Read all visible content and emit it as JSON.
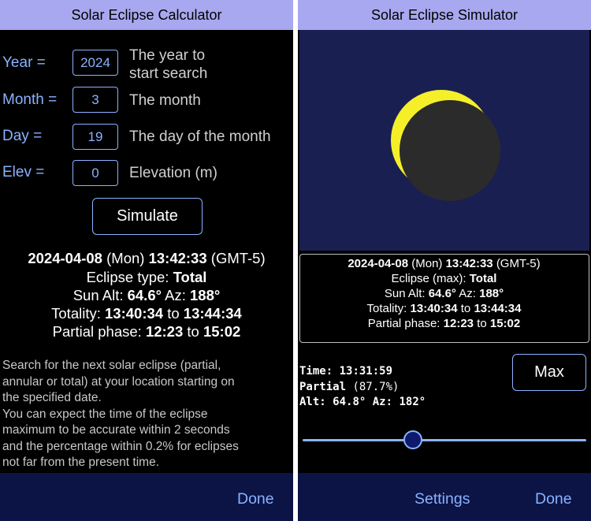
{
  "calculator": {
    "title": "Solar Eclipse Calculator",
    "fields": [
      {
        "label": "Year =",
        "value": "2024",
        "desc1": "The year to",
        "desc2": "start search"
      },
      {
        "label": "Month =",
        "value": "3",
        "desc1": "The month"
      },
      {
        "label": "Day =",
        "value": "19",
        "desc1": "The day of the month"
      },
      {
        "label": "Elev =",
        "value": "0",
        "desc1": "Elevation (m)"
      }
    ],
    "simulate_label": "Simulate",
    "result": {
      "date": "2024-04-08",
      "weekday": "(Mon)",
      "time": "13:42:33",
      "tz": "(GMT-5)",
      "type_label": "Eclipse type:",
      "type_value": "Total",
      "alt_label": "Sun Alt:",
      "alt_value": "64.6°",
      "az_label": "Az:",
      "az_value": "188°",
      "totality_label": "Totality:",
      "totality_start": "13:40:34",
      "totality_to": "to",
      "totality_end": "13:44:34",
      "partial_label": "Partial phase:",
      "partial_start": "12:23",
      "partial_to": "to",
      "partial_end": "15:02"
    },
    "description": [
      "Search for the next solar eclipse (partial,",
      "annular or total) at your location starting on",
      "the specified date.",
      "You can expect the time of the eclipse",
      "maximum to be accurate within 2 seconds",
      "and the percentage within 0.2% for eclipses",
      "not far from the present time."
    ],
    "done_label": "Done"
  },
  "simulator": {
    "title": "Solar Eclipse Simulator",
    "info": {
      "date": "2024-04-08",
      "weekday": "(Mon)",
      "time": "13:42:33",
      "tz": "(GMT-5)",
      "eclipse_label": "Eclipse (max):",
      "eclipse_value": "Total",
      "alt_label": "Sun Alt:",
      "alt_value": "64.6°",
      "az_label": "Az:",
      "az_value": "188°",
      "totality_label": "Totality:",
      "totality_start": "13:40:34",
      "totality_to": "to",
      "totality_end": "13:44:34",
      "partial_label": "Partial phase:",
      "partial_start": "12:23",
      "partial_to": "to",
      "partial_end": "15:02"
    },
    "status": {
      "time_label": "Time:",
      "time_value": "13:31:59",
      "phase_label": "Partial",
      "phase_pct": "(87.7%)",
      "alt_label": "Alt:",
      "alt_value": "64.8°",
      "az_label": "Az:",
      "az_value": "182°"
    },
    "max_label": "Max",
    "slider_fraction": 0.38,
    "settings_label": "Settings",
    "done_label": "Done",
    "colors": {
      "sun": "#f5ef2a",
      "moon": "#2b2b2b",
      "sky": "#1a1f52",
      "accent": "#8ab2ff"
    }
  }
}
